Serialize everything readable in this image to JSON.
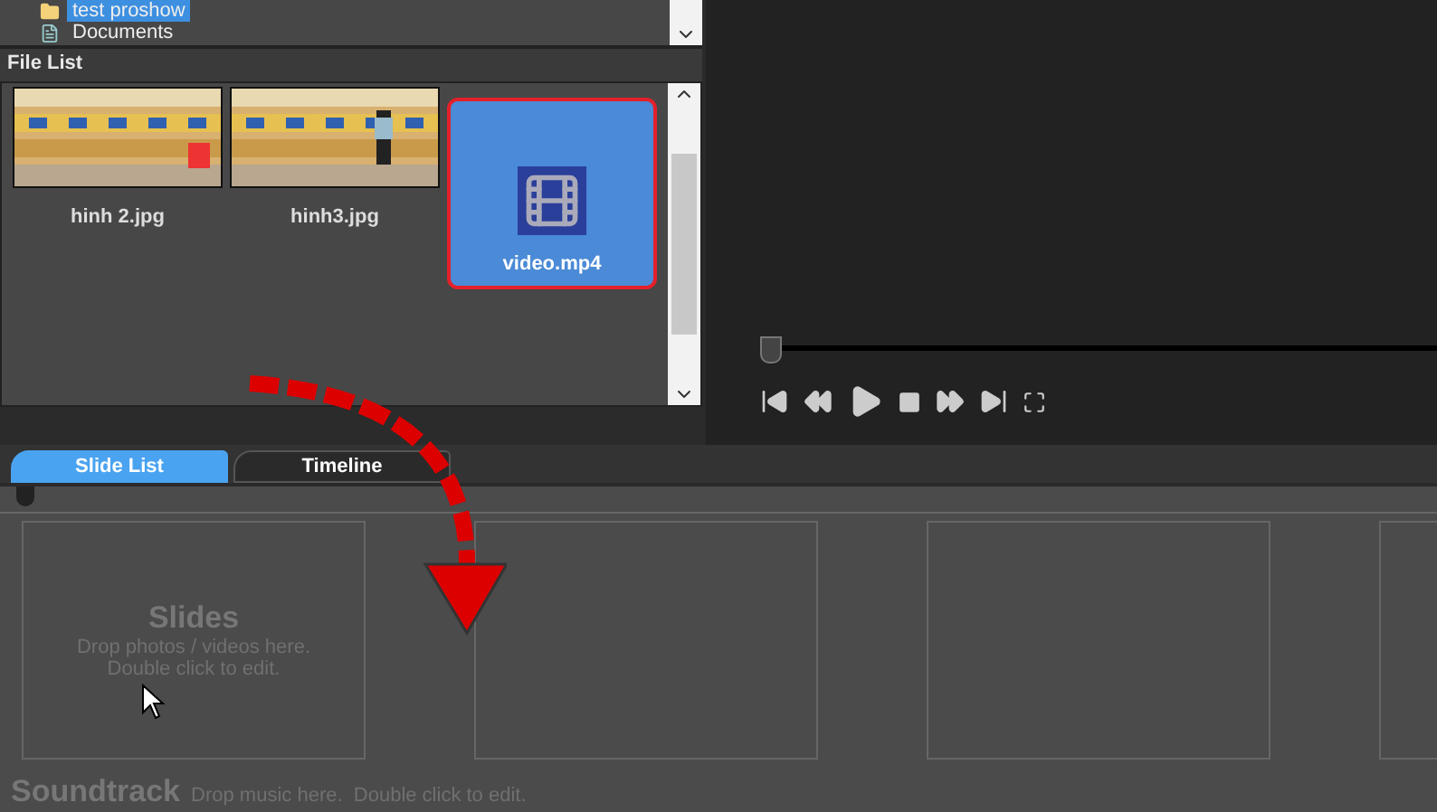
{
  "folder_tree": {
    "items": [
      {
        "label": "test proshow",
        "kind": "folder",
        "selected": true
      },
      {
        "label": "Documents",
        "kind": "document",
        "selected": false
      }
    ]
  },
  "file_list": {
    "title": "File List",
    "files": [
      {
        "name": "hinh 2.jpg",
        "kind": "picture",
        "selected": false
      },
      {
        "name": "hinh3.jpg",
        "kind": "picture",
        "selected": false
      },
      {
        "name": "video.mp4",
        "kind": "video",
        "selected": true
      }
    ]
  },
  "preview": {
    "position": {
      "level": 0
    }
  },
  "tabs": [
    {
      "label": "Slide List",
      "selected": true
    },
    {
      "label": "Timeline",
      "selected": false
    }
  ],
  "slide_list": {
    "title": "Slides",
    "hint_lines": [
      "Drop photos / videos here.",
      "Double click to edit."
    ]
  },
  "soundtrack": {
    "title": "Soundtrack",
    "hint": "Drop music here.  Double click to edit."
  }
}
